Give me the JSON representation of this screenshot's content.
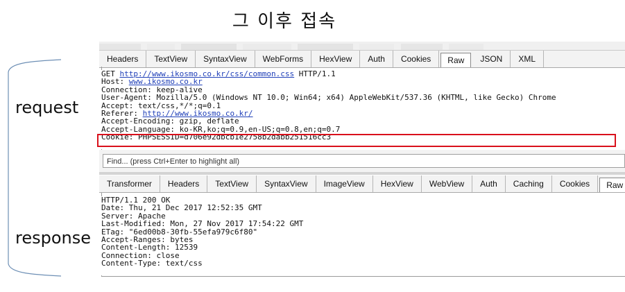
{
  "title": "그 이후 접속",
  "labels": {
    "request": "request",
    "response": "response"
  },
  "request_panel": {
    "tabs": [
      "Headers",
      "TextView",
      "SyntaxView",
      "WebForms",
      "HexView",
      "Auth",
      "Cookies",
      "Raw",
      "JSON",
      "XML"
    ],
    "active_tab": "Raw",
    "lines": {
      "l1_pre": "GET ",
      "l1_link": "http://www.ikosmo.co.kr/css/common.css",
      "l1_post": " HTTP/1.1",
      "l2_pre": "Host: ",
      "l2_link": "www.ikosmo.co.kr",
      "l3": "Connection: keep-alive",
      "l4": "User-Agent: Mozilla/5.0 (Windows NT 10.0; Win64; x64) AppleWebKit/537.36 (KHTML, like Gecko) Chrome",
      "l5": "Accept: text/css,*/*;q=0.1",
      "l6_pre": "Referer: ",
      "l6_link": "http://www.ikosmo.co.kr/",
      "l7": "Accept-Encoding: gzip, deflate",
      "l8": "Accept-Language: ko-KR,ko;q=0.9,en-US;q=0.8,en;q=0.7",
      "l9": "Cookie: PHPSESSID=d706e92dbcb1e2758b2dabb251516cc3"
    },
    "find_placeholder": "Find... (press Ctrl+Enter to highlight all)"
  },
  "response_panel": {
    "tabs": [
      "Transformer",
      "Headers",
      "TextView",
      "SyntaxView",
      "ImageView",
      "HexView",
      "WebView",
      "Auth",
      "Caching",
      "Cookies",
      "Raw"
    ],
    "active_tab": "Raw",
    "lines": [
      "HTTP/1.1 200 OK",
      "Date: Thu, 21 Dec 2017 12:52:35 GMT",
      "Server: Apache",
      "Last-Modified: Mon, 27 Nov 2017 17:54:22 GMT",
      "ETag: \"6ed00b8-30fb-55efa979c6f80\"",
      "Accept-Ranges: bytes",
      "Content-Length: 12539",
      "Connection: close",
      "Content-Type: text/css"
    ]
  },
  "colors": {
    "highlight": "#d9101b",
    "link": "#1f3fb8"
  }
}
